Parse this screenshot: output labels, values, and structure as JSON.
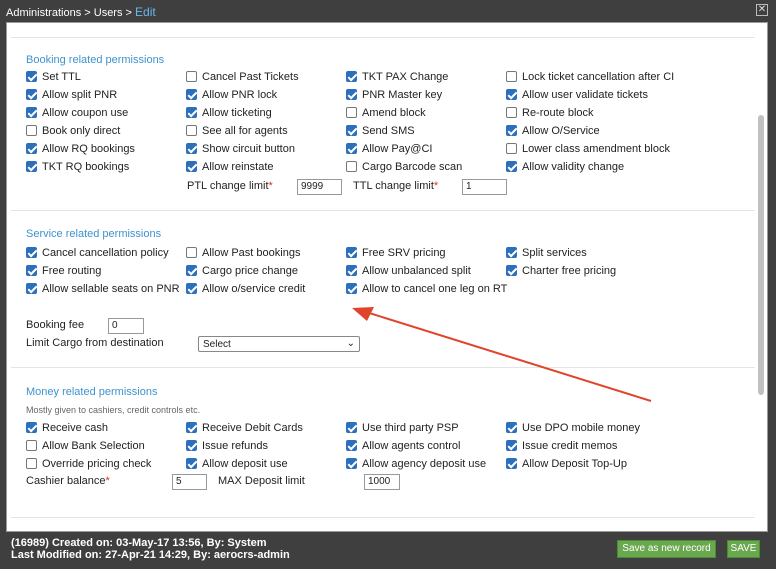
{
  "breadcrumb": {
    "admin": "Administrations",
    "sep1": " > ",
    "users": "Users",
    "sep2": " > ",
    "edit": "Edit"
  },
  "booking": {
    "title": "Booking related permissions",
    "items": [
      {
        "label": "Set TTL",
        "checked": true
      },
      {
        "label": "Cancel Past Tickets",
        "checked": false
      },
      {
        "label": "TKT PAX Change",
        "checked": true
      },
      {
        "label": "Lock ticket cancellation after CI",
        "checked": false
      },
      {
        "label": "Allow split PNR",
        "checked": true
      },
      {
        "label": "Allow PNR lock",
        "checked": true
      },
      {
        "label": "PNR Master key",
        "checked": true
      },
      {
        "label": "Allow user validate tickets",
        "checked": true
      },
      {
        "label": "Allow coupon use",
        "checked": true
      },
      {
        "label": "Allow ticketing",
        "checked": true
      },
      {
        "label": "Amend block",
        "checked": false
      },
      {
        "label": "Re-route block",
        "checked": false
      },
      {
        "label": "Book only direct",
        "checked": false
      },
      {
        "label": "See all for agents",
        "checked": false
      },
      {
        "label": "Send SMS",
        "checked": true
      },
      {
        "label": "Allow O/Service",
        "checked": true
      },
      {
        "label": "Allow RQ bookings",
        "checked": true
      },
      {
        "label": "Show circuit button",
        "checked": true
      },
      {
        "label": "Allow Pay@CI",
        "checked": true
      },
      {
        "label": "Lower class amendment block",
        "checked": false
      },
      {
        "label": "TKT RQ bookings",
        "checked": true
      },
      {
        "label": "Allow reinstate",
        "checked": true
      },
      {
        "label": "Cargo Barcode scan",
        "checked": false
      },
      {
        "label": "Allow validity change",
        "checked": true
      }
    ],
    "ptl_label": "PTL change limit",
    "ptl_value": "9999",
    "ttl_label": "TTL change limit",
    "ttl_value": "1",
    "required_mark": "*"
  },
  "service": {
    "title": "Service related permissions",
    "items": [
      {
        "label": "Cancel cancellation policy",
        "checked": true
      },
      {
        "label": "Allow Past bookings",
        "checked": false
      },
      {
        "label": "Free SRV pricing",
        "checked": true
      },
      {
        "label": "Split services",
        "checked": true
      },
      {
        "label": "Free routing",
        "checked": true
      },
      {
        "label": "Cargo price change",
        "checked": true
      },
      {
        "label": "Allow unbalanced split",
        "checked": true
      },
      {
        "label": "Charter free pricing",
        "checked": true
      },
      {
        "label": "Allow sellable seats on PNR",
        "checked": true
      },
      {
        "label": "Allow o/service credit",
        "checked": true
      },
      {
        "label": "Allow to cancel one leg on RT",
        "checked": true
      }
    ],
    "booking_fee_label": "Booking fee",
    "booking_fee_value": "0",
    "limit_cargo_label": "Limit Cargo from destination",
    "limit_cargo_value": "Select"
  },
  "money": {
    "title": "Money related permissions",
    "subtitle": "Mostly given to cashiers, credit controls etc.",
    "items": [
      {
        "label": "Receive cash",
        "checked": true
      },
      {
        "label": "Receive Debit Cards",
        "checked": true
      },
      {
        "label": "Use third party PSP",
        "checked": true
      },
      {
        "label": "Use DPO mobile money",
        "checked": true
      },
      {
        "label": "Allow Bank Selection",
        "checked": false
      },
      {
        "label": "Issue refunds",
        "checked": true
      },
      {
        "label": "Allow agents control",
        "checked": true
      },
      {
        "label": "Issue credit memos",
        "checked": true
      },
      {
        "label": "Override pricing check",
        "checked": false
      },
      {
        "label": "Allow deposit use",
        "checked": true
      },
      {
        "label": "Allow agency deposit use",
        "checked": true
      },
      {
        "label": "Allow Deposit Top-Up",
        "checked": true
      }
    ],
    "cashier_label": "Cashier balance",
    "cashier_value": "5",
    "max_deposit_label": "MAX Deposit limit",
    "max_deposit_value": "1000"
  },
  "footer": {
    "created": "(16989) Created on: 03-May-17 13:56, By: System",
    "modified": "Last Modified on: 27-Apr-21 14:29, By: aerocrs-admin",
    "save_new_label": "Save as new record",
    "save_label": "SAVE"
  },
  "colors": {
    "accent": "#3d93cf",
    "checkbox": "#2c6fbd",
    "button": "#6aa84f",
    "arrow": "#e0442b"
  }
}
